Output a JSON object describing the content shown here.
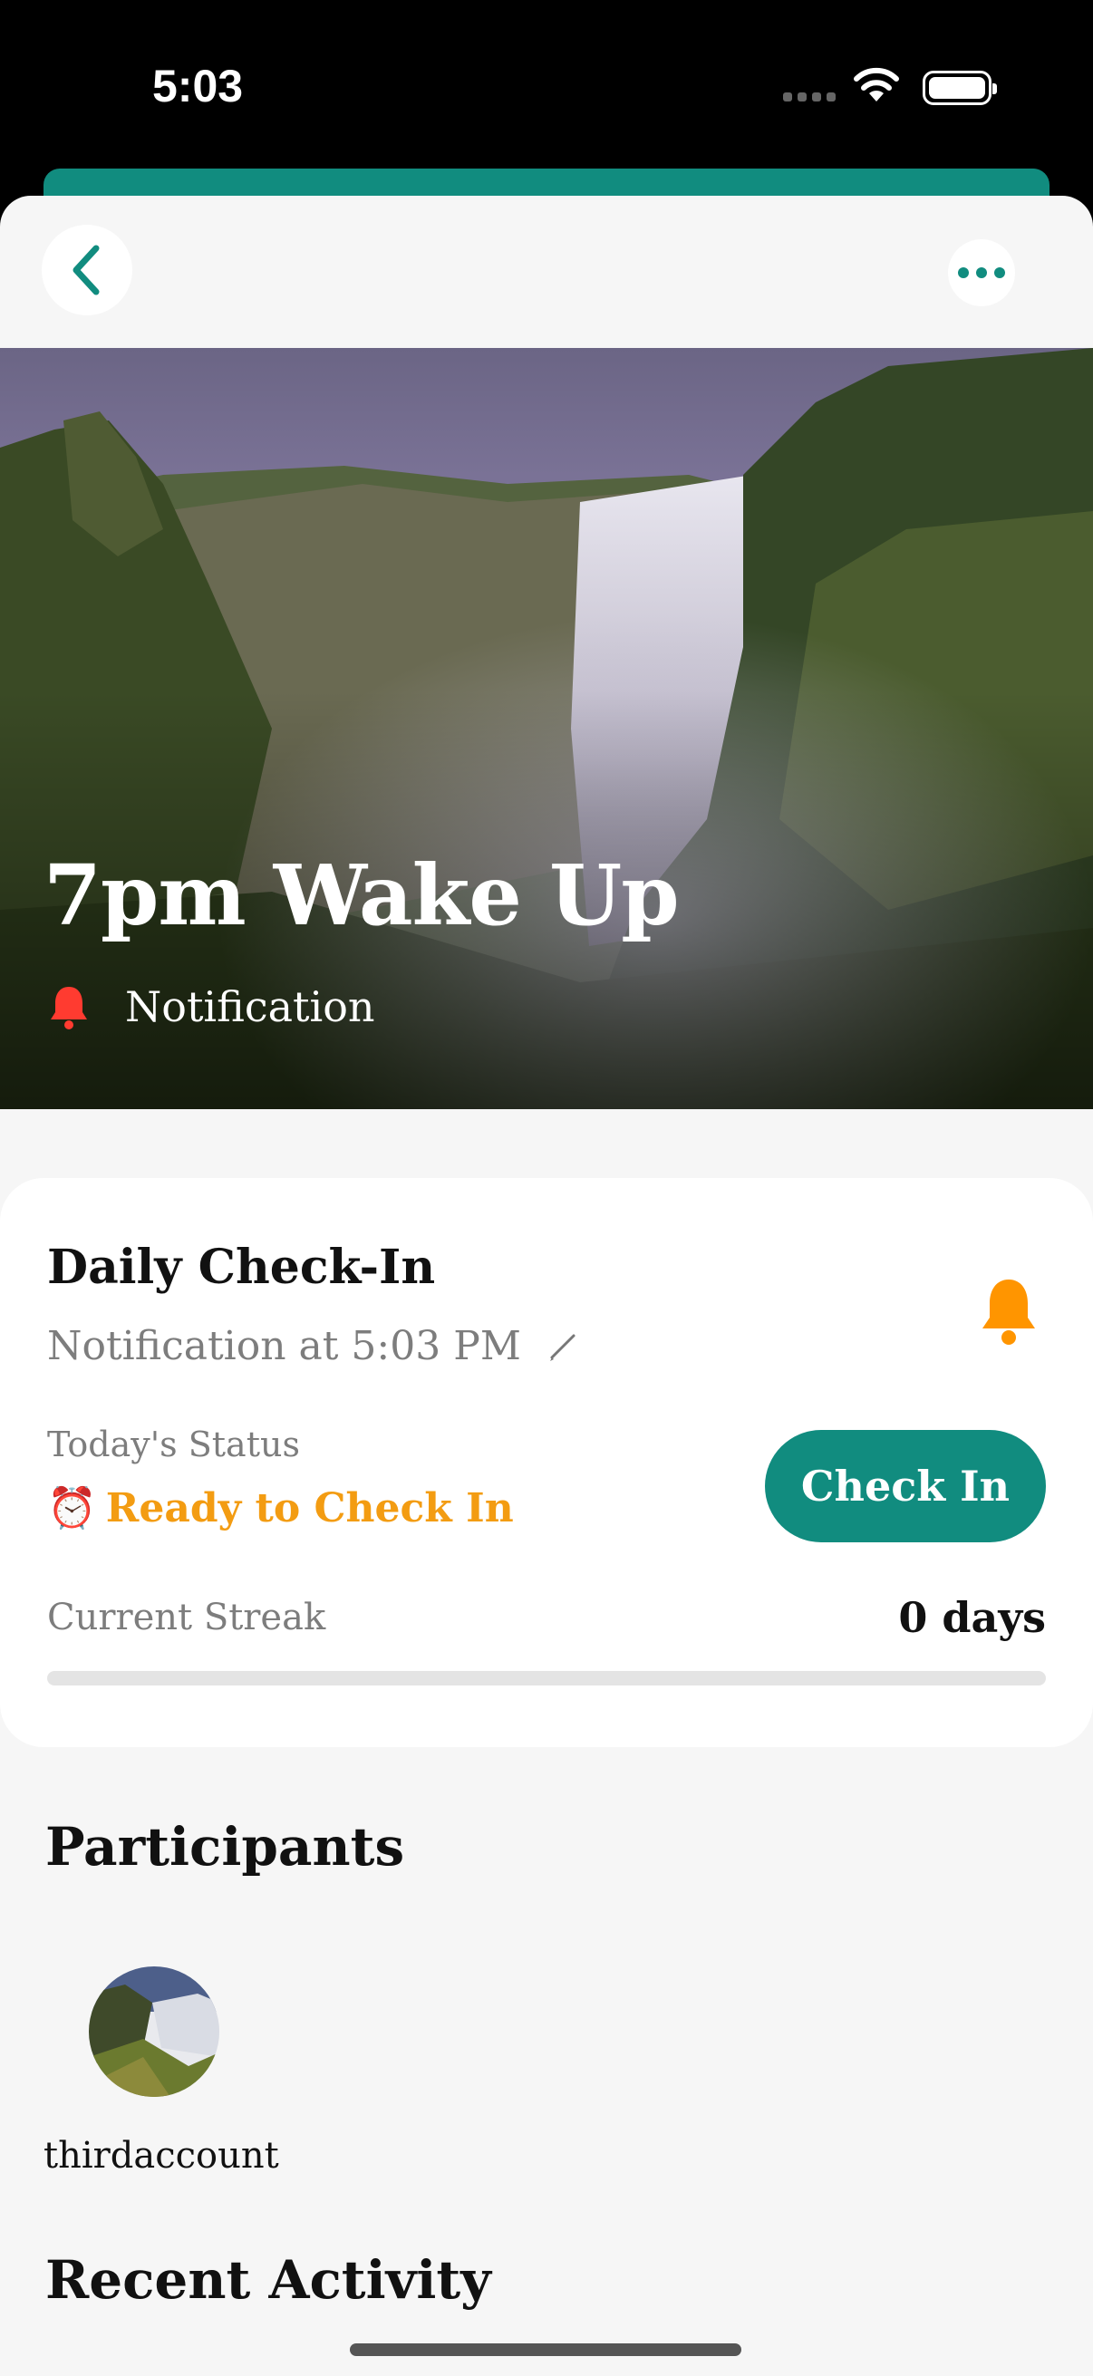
{
  "status_bar": {
    "time": "5:03"
  },
  "hero": {
    "title": "7pm Wake Up",
    "meta_label": "Notification"
  },
  "checkin_card": {
    "title": "Daily Check-In",
    "notification_text": "Notification at 5:03 PM",
    "status_label": "Today's Status",
    "status_emoji": "⏰",
    "status_value": "Ready to Check In",
    "button_label": "Check In",
    "streak_label": "Current Streak",
    "streak_value": "0 days",
    "streak_progress": 0
  },
  "participants": {
    "title": "Participants",
    "items": [
      {
        "name": "thirdaccount"
      }
    ]
  },
  "recent_activity": {
    "title": "Recent Activity"
  },
  "colors": {
    "accent": "#118c7f",
    "status": "#f39c12",
    "bell_red": "#ff3b30",
    "bell_orange": "#ff9500"
  },
  "icons": [
    "chevron-left-icon",
    "more-icon",
    "bell-icon",
    "pencil-icon",
    "alarm-clock-icon",
    "wifi-icon",
    "battery-icon"
  ]
}
